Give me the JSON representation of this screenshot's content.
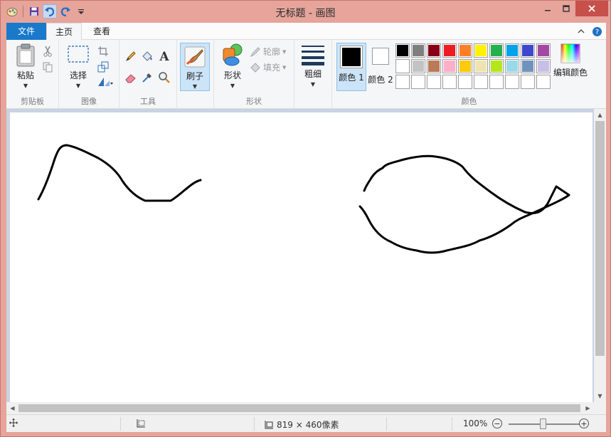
{
  "window": {
    "title": "无标题 - 画图"
  },
  "tabs": {
    "file": "文件",
    "home": "主页",
    "view": "查看"
  },
  "ribbon": {
    "clipboard": {
      "label": "剪贴板",
      "paste": "粘贴"
    },
    "image": {
      "label": "图像",
      "select": "选择"
    },
    "tools": {
      "label": "工具"
    },
    "brush": {
      "label": "刷子"
    },
    "shapes": {
      "label": "形状",
      "shapes_btn": "形状",
      "outline": "轮廓",
      "fill": "填充"
    },
    "size": {
      "label": "粗细"
    },
    "colors": {
      "label": "颜色",
      "color1": "颜色 1",
      "color2": "颜色 2",
      "edit": "编辑颜色",
      "color1_value": "#000000",
      "color2_value": "#ffffff",
      "palette_row1": [
        "#000000",
        "#7f7f7f",
        "#880015",
        "#ed1c24",
        "#ff7f27",
        "#fff200",
        "#22b14c",
        "#00a2e8",
        "#3f48cc",
        "#a349a4"
      ],
      "palette_row2": [
        "#ffffff",
        "#c3c3c3",
        "#b97a57",
        "#ffaec9",
        "#ffc90e",
        "#efe4b0",
        "#b5e61d",
        "#99d9ea",
        "#7092be",
        "#c8bfe7"
      ]
    }
  },
  "status": {
    "canvas_size": "819 × 460像素",
    "zoom": "100%"
  },
  "icons": {
    "paint": "paint-app-icon",
    "save": "save-icon",
    "undo": "undo-icon",
    "redo": "redo-icon"
  }
}
